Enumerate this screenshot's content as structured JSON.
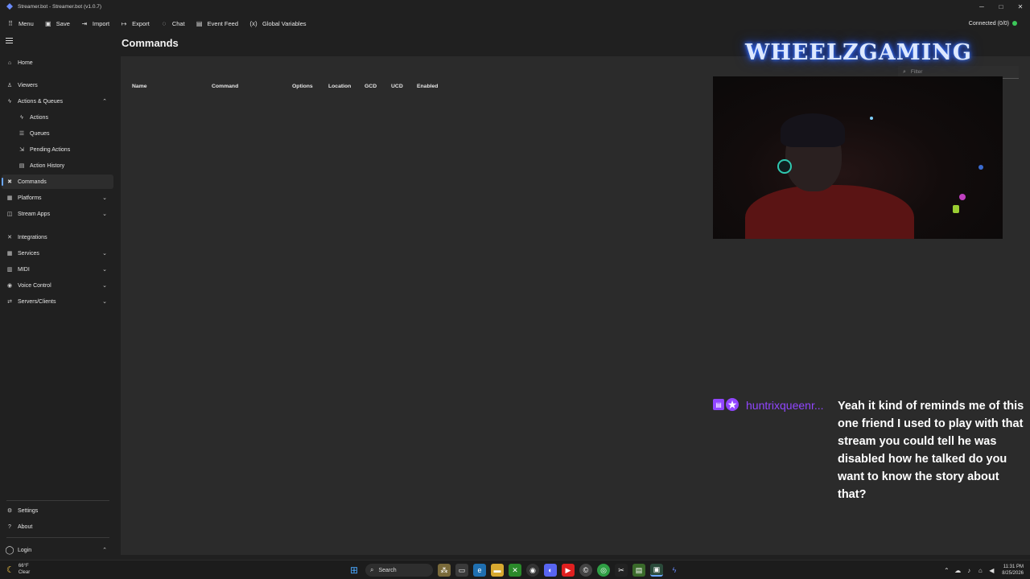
{
  "window": {
    "title": "Streamer.bot - Streamer.bot (v1.0.7)",
    "minimize": "─",
    "maximize": "□",
    "close": "✕"
  },
  "toolbar": {
    "items": [
      {
        "label": "Menu",
        "icon": "⠿"
      },
      {
        "label": "Save",
        "icon": "▣"
      },
      {
        "label": "Import",
        "icon": "⇥"
      },
      {
        "label": "Export",
        "icon": "↦"
      },
      {
        "label": "Chat",
        "icon": "◌"
      },
      {
        "label": "Event Feed",
        "icon": "▤"
      },
      {
        "label": "Global Variables",
        "icon": "(x)"
      }
    ],
    "status": "Connected (0/0)",
    "status_color": "#3cc85a"
  },
  "sidebar": {
    "items": [
      {
        "label": "Home",
        "icon": "⌂"
      },
      {
        "label": "Viewers",
        "icon": "♙"
      },
      {
        "label": "Actions & Queues",
        "icon": "ϟ",
        "chevron": "⌃"
      },
      {
        "label": "Actions",
        "icon": "ϟ"
      },
      {
        "label": "Queues",
        "icon": "☰"
      },
      {
        "label": "Pending Actions",
        "icon": "⇲"
      },
      {
        "label": "Action History",
        "icon": "▤"
      },
      {
        "label": "Commands",
        "icon": "✖"
      },
      {
        "label": "Platforms",
        "icon": "▦",
        "chevron": "⌄"
      },
      {
        "label": "Stream Apps",
        "icon": "◫",
        "chevron": "⌄"
      },
      {
        "label": "Integrations",
        "icon": "✕"
      },
      {
        "label": "Services",
        "icon": "▦",
        "chevron": "⌄"
      },
      {
        "label": "MIDI",
        "icon": "▥",
        "chevron": "⌄"
      },
      {
        "label": "Voice Control",
        "icon": "◉",
        "chevron": "⌄"
      },
      {
        "label": "Servers/Clients",
        "icon": "⇄",
        "chevron": "⌄"
      }
    ],
    "bottom": [
      {
        "label": "Settings",
        "icon": "⚙"
      },
      {
        "label": "About",
        "icon": "?"
      },
      {
        "label": "Login",
        "icon": "◯",
        "chevron": "⌃"
      }
    ]
  },
  "page": {
    "title": "Commands",
    "columns": [
      "Name",
      "Command",
      "Options",
      "Location",
      "GCD",
      "UCD",
      "Enabled"
    ],
    "filter_placeholder": "Filter"
  },
  "overlay": {
    "channel_title": "WHEELZGAMING",
    "chat": {
      "username": "huntrixqueenr...",
      "message": "Yeah it kind of reminds me of this one friend I used to play with that stream you could tell he was disabled how he talked do you want to know the story about that?",
      "username_color": "#9146ff"
    }
  },
  "taskbar": {
    "weather_temp": "66°F",
    "weather_desc": "Clear",
    "search_label": "Search",
    "time": "11:31 PM",
    "date": "8/25/2026"
  }
}
